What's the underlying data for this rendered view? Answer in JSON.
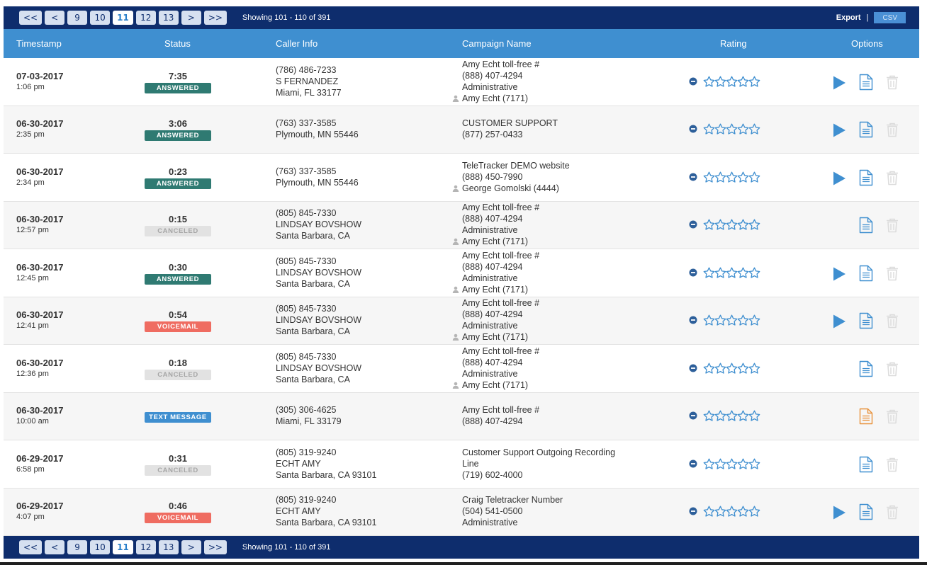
{
  "pagination": {
    "first": "<<",
    "prev": "<",
    "pages": [
      "9",
      "10",
      "11",
      "12",
      "13"
    ],
    "active_page": "11",
    "next": ">",
    "last": ">>",
    "showing": "Showing 101 - 110 of 391"
  },
  "export": {
    "label": "Export",
    "separator": "|",
    "csv": "CSV"
  },
  "columns": {
    "timestamp": "Timestamp",
    "status": "Status",
    "caller_info": "Caller Info",
    "campaign_name": "Campaign Name",
    "rating": "Rating",
    "options": "Options"
  },
  "rows": [
    {
      "date": "07-03-2017",
      "time": "1:06 pm",
      "duration": "7:35",
      "status": "ANSWERED",
      "status_type": "answered",
      "caller": [
        "(786) 486-7233",
        "S FERNANDEZ",
        "Miami, FL 33177"
      ],
      "campaign": [
        "Amy Echt toll-free #",
        "(888) 407-4294",
        "Administrative"
      ],
      "agent": "Amy Echt (7171)",
      "has_recording": true,
      "doc_color": "blue"
    },
    {
      "date": "06-30-2017",
      "time": "2:35 pm",
      "duration": "3:06",
      "status": "ANSWERED",
      "status_type": "answered",
      "caller": [
        "(763) 337-3585",
        "Plymouth, MN 55446"
      ],
      "campaign": [
        "CUSTOMER SUPPORT",
        "(877) 257-0433"
      ],
      "agent": "",
      "has_recording": true,
      "doc_color": "blue"
    },
    {
      "date": "06-30-2017",
      "time": "2:34 pm",
      "duration": "0:23",
      "status": "ANSWERED",
      "status_type": "answered",
      "caller": [
        "(763) 337-3585",
        "Plymouth, MN 55446"
      ],
      "campaign": [
        "TeleTracker DEMO website",
        "(888) 450-7990"
      ],
      "agent": "George Gomolski (4444)",
      "has_recording": true,
      "doc_color": "blue"
    },
    {
      "date": "06-30-2017",
      "time": "12:57 pm",
      "duration": "0:15",
      "status": "CANCELED",
      "status_type": "canceled",
      "caller": [
        "(805) 845-7330",
        "LINDSAY BOVSHOW",
        "Santa Barbara, CA"
      ],
      "campaign": [
        "Amy Echt toll-free #",
        "(888) 407-4294",
        "Administrative"
      ],
      "agent": "Amy Echt (7171)",
      "has_recording": false,
      "doc_color": "blue"
    },
    {
      "date": "06-30-2017",
      "time": "12:45 pm",
      "duration": "0:30",
      "status": "ANSWERED",
      "status_type": "answered",
      "caller": [
        "(805) 845-7330",
        "LINDSAY BOVSHOW",
        "Santa Barbara, CA"
      ],
      "campaign": [
        "Amy Echt toll-free #",
        "(888) 407-4294",
        "Administrative"
      ],
      "agent": "Amy Echt (7171)",
      "has_recording": true,
      "doc_color": "blue"
    },
    {
      "date": "06-30-2017",
      "time": "12:41 pm",
      "duration": "0:54",
      "status": "VOICEMAIL",
      "status_type": "voicemail",
      "caller": [
        "(805) 845-7330",
        "LINDSAY BOVSHOW",
        "Santa Barbara, CA"
      ],
      "campaign": [
        "Amy Echt toll-free #",
        "(888) 407-4294",
        "Administrative"
      ],
      "agent": "Amy Echt (7171)",
      "has_recording": true,
      "doc_color": "blue"
    },
    {
      "date": "06-30-2017",
      "time": "12:36 pm",
      "duration": "0:18",
      "status": "CANCELED",
      "status_type": "canceled",
      "caller": [
        "(805) 845-7330",
        "LINDSAY BOVSHOW",
        "Santa Barbara, CA"
      ],
      "campaign": [
        "Amy Echt toll-free #",
        "(888) 407-4294",
        "Administrative"
      ],
      "agent": "Amy Echt (7171)",
      "has_recording": false,
      "doc_color": "blue"
    },
    {
      "date": "06-30-2017",
      "time": "10:00 am",
      "duration": "",
      "status": "TEXT MESSAGE",
      "status_type": "text",
      "caller": [
        "(305) 306-4625",
        "Miami, FL 33179"
      ],
      "campaign": [
        "Amy Echt toll-free #",
        "(888) 407-4294"
      ],
      "agent": "",
      "has_recording": false,
      "doc_color": "orange"
    },
    {
      "date": "06-29-2017",
      "time": "6:58 pm",
      "duration": "0:31",
      "status": "CANCELED",
      "status_type": "canceled",
      "caller": [
        "(805) 319-9240",
        "ECHT AMY",
        "Santa Barbara, CA 93101"
      ],
      "campaign": [
        "Customer Support Outgoing Recording",
        "Line",
        "(719) 602-4000"
      ],
      "agent": "",
      "has_recording": false,
      "doc_color": "blue"
    },
    {
      "date": "06-29-2017",
      "time": "4:07 pm",
      "duration": "0:46",
      "status": "VOICEMAIL",
      "status_type": "voicemail",
      "caller": [
        "(805) 319-9240",
        "ECHT AMY",
        "Santa Barbara, CA 93101"
      ],
      "campaign": [
        "Craig Teletracker Number",
        "(504) 541-0500",
        "Administrative"
      ],
      "agent": "",
      "has_recording": true,
      "doc_color": "blue"
    }
  ],
  "rating_stars": 5,
  "colors": {
    "navy": "#0e2d6d",
    "header_blue": "#3f8fd0",
    "answered": "#2f7a72",
    "voicemail": "#ef6c61",
    "text_message": "#3f8fd0",
    "icon_blue": "#3f8fd0",
    "doc_orange": "#e8913a"
  }
}
